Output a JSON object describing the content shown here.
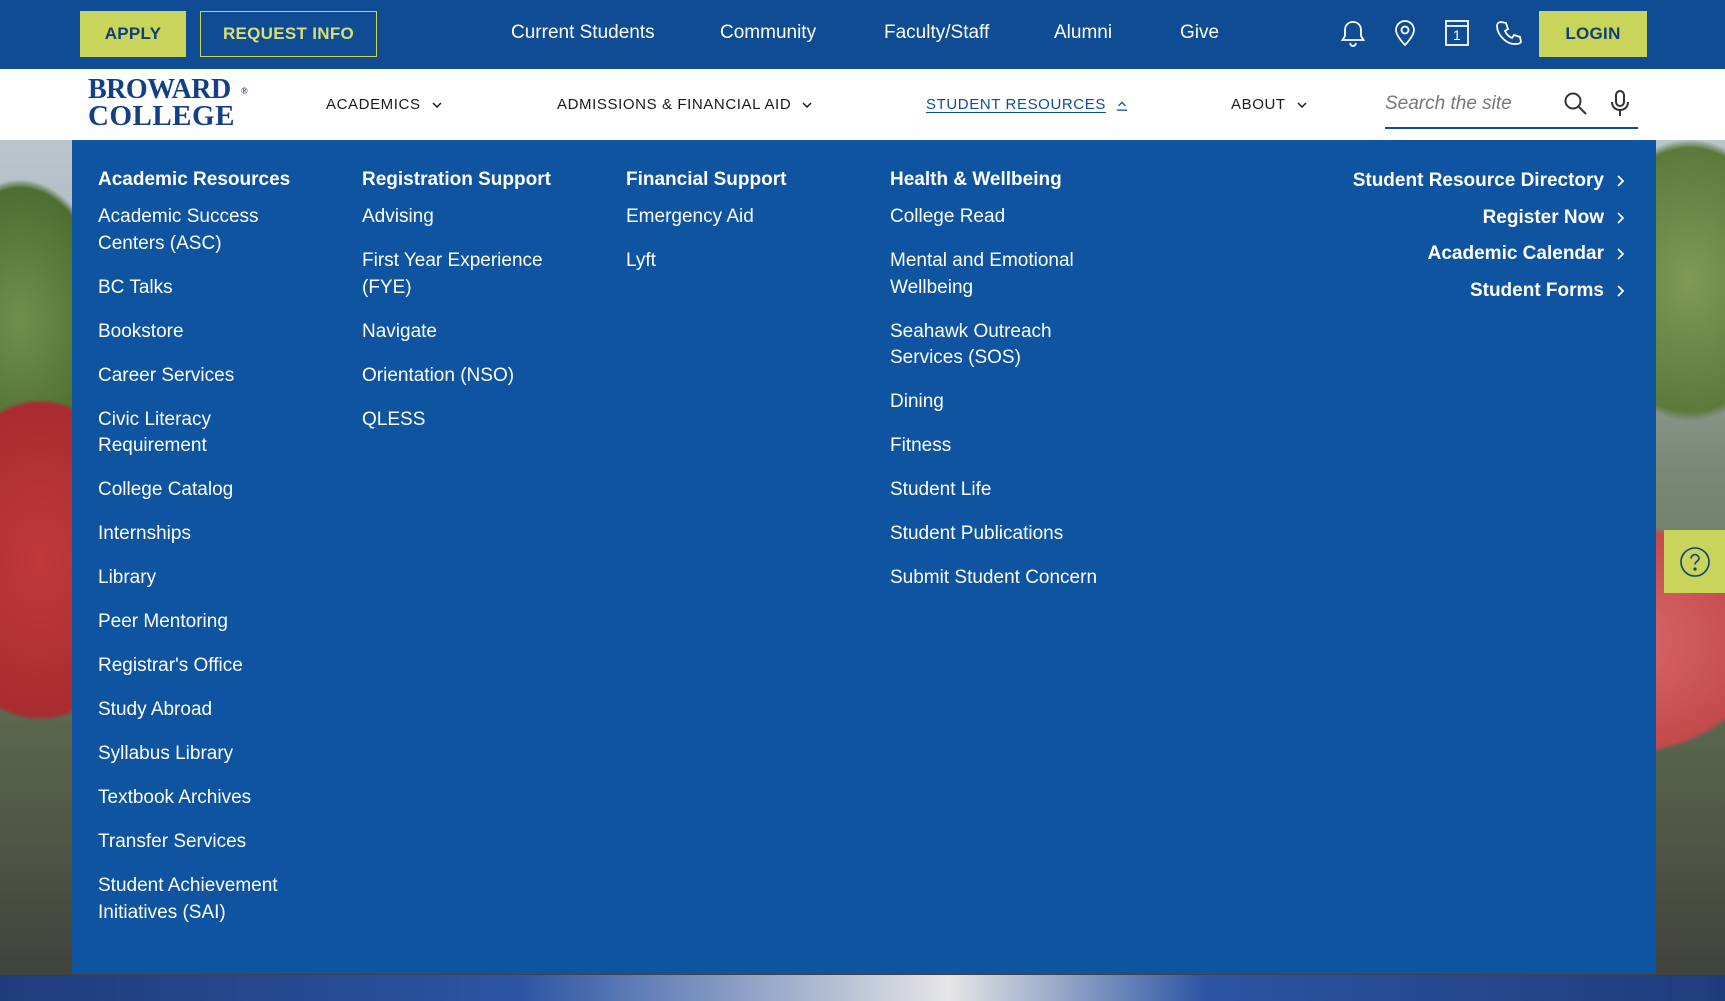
{
  "utility": {
    "apply_label": "APPLY",
    "request_label": "REQUEST INFO",
    "links": [
      "Current Students",
      "Community",
      "Faculty/Staff",
      "Alumni",
      "Give"
    ],
    "icons": [
      "bell-icon",
      "location-pin-icon",
      "calendar-icon",
      "phone-icon"
    ],
    "calendar_day": "1",
    "login_label": "LOGIN"
  },
  "brand": {
    "logo_line1": "BROWARD",
    "logo_line2": "COLLEGE",
    "trademark": "®"
  },
  "nav": {
    "items": [
      {
        "label": "ACADEMICS",
        "expanded": false
      },
      {
        "label": "ADMISSIONS & FINANCIAL AID",
        "expanded": false
      },
      {
        "label": "STUDENT RESOURCES",
        "expanded": true
      },
      {
        "label": "ABOUT",
        "expanded": false
      }
    ],
    "search_placeholder": "Search the site"
  },
  "mega_menu": {
    "columns": [
      {
        "heading": "Academic Resources",
        "links": [
          "Academic Success Centers (ASC)",
          "BC Talks",
          "Bookstore",
          "Career Services",
          "Civic Literacy Requirement",
          "College Catalog",
          "Internships",
          "Library",
          "Peer Mentoring",
          "Registrar's Office",
          "Study Abroad",
          "Syllabus Library",
          "Textbook Archives",
          "Transfer Services",
          "Student Achievement Initiatives (SAI)"
        ]
      },
      {
        "heading": "Registration Support",
        "links": [
          "Advising",
          "First Year Experience (FYE)",
          "Navigate",
          "Orientation (NSO)",
          "QLESS"
        ]
      },
      {
        "heading": "Financial Support",
        "links": [
          "Emergency Aid",
          "Lyft"
        ]
      },
      {
        "heading": "Health & Wellbeing",
        "links": [
          "College Read",
          "Mental and Emotional Wellbeing",
          "Seahawk Outreach Services (SOS)",
          "Dining",
          "Fitness",
          "Student Life",
          "Student Publications",
          "Submit Student Concern"
        ]
      }
    ],
    "quick_links": [
      "Student Resource Directory",
      "Register Now",
      "Academic Calendar",
      "Student Forms"
    ]
  },
  "colors": {
    "primary_blue": "#0f4c93",
    "menu_blue": "#0f54a0",
    "accent_yellow": "#c9d45a"
  }
}
